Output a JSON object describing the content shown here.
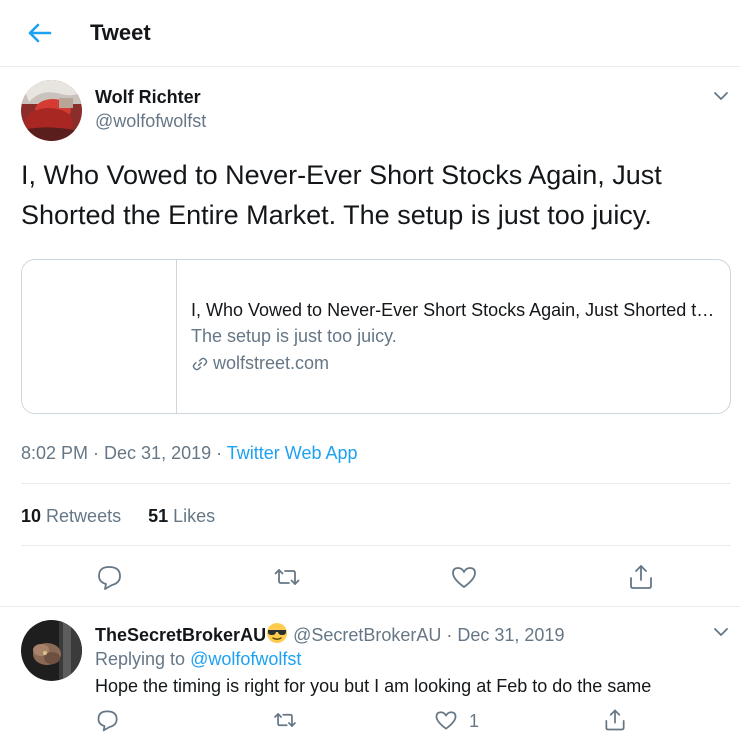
{
  "header": {
    "title": "Tweet",
    "back_icon": "arrow-left-icon",
    "accent_color": "#1da1f2"
  },
  "main_tweet": {
    "author_name": "Wolf Richter",
    "author_handle": "@wolfofwolfst",
    "text": "I, Who Vowed to Never-Ever Short Stocks Again, Just Shorted the Entire Market. The setup is just too juicy.",
    "card": {
      "title": "I, Who Vowed to Never-Ever Short Stocks Again, Just Shorted the Entire Market.",
      "description": "The setup is just too juicy.",
      "domain": "wolfstreet.com",
      "link_icon": "link-icon"
    },
    "timestamp": "8:02 PM · Dec 31, 2019 · ",
    "source": "Twitter Web App",
    "stats": {
      "retweets_count": "10",
      "retweets_label": "Retweets",
      "likes_count": "51",
      "likes_label": "Likes"
    },
    "actions": [
      "reply-icon",
      "retweet-icon",
      "like-icon",
      "share-icon"
    ]
  },
  "reply": {
    "author_name": "TheSecretBrokerAU",
    "emoji": "sunglasses-emoji",
    "meta": " @SecretBrokerAU · Dec 31, 2019",
    "replying_label": "Replying to ",
    "replying_to": "@wolfofwolfst",
    "text": "Hope the timing is right for you but I am looking at Feb to do the same",
    "like_count": "1",
    "actions": [
      "reply-icon",
      "retweet-icon",
      "like-icon",
      "share-icon"
    ]
  },
  "colors": {
    "primary_text": "#14171a",
    "secondary_text": "#657786",
    "border": "#e6ecf0",
    "link": "#1da1f2"
  }
}
